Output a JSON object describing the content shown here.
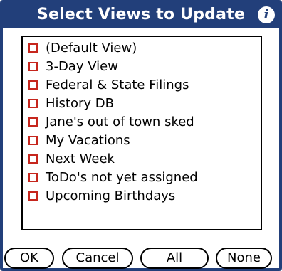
{
  "dialog": {
    "title": "Select Views to Update",
    "info_icon": "info-icon",
    "info_glyph": "i"
  },
  "views": [
    {
      "label": "(Default View)",
      "checked": false
    },
    {
      "label": "3-Day View",
      "checked": false
    },
    {
      "label": "Federal & State Filings",
      "checked": false
    },
    {
      "label": "History DB",
      "checked": false
    },
    {
      "label": "Jane's out of town sked",
      "checked": false
    },
    {
      "label": "My Vacations",
      "checked": false
    },
    {
      "label": "Next Week",
      "checked": false
    },
    {
      "label": "ToDo's not yet assigned",
      "checked": false
    },
    {
      "label": "Upcoming Birthdays",
      "checked": false
    }
  ],
  "buttons": {
    "ok": "OK",
    "cancel": "Cancel",
    "all": "All",
    "none": "None"
  },
  "colors": {
    "titlebar": "#223f7a",
    "checkbox_border": "#c6261d"
  }
}
